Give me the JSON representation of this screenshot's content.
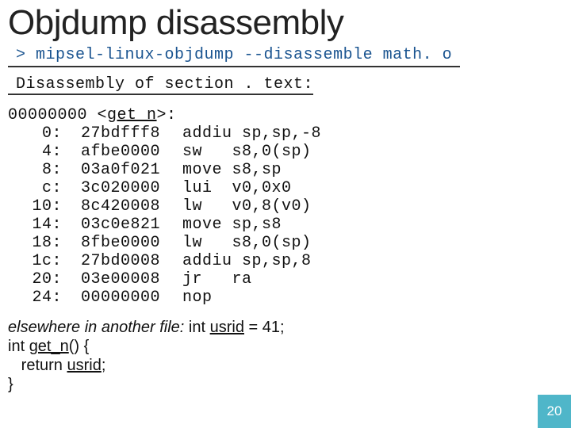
{
  "title": "Objdump disassembly",
  "command": "> mipsel-linux-objdump --disassemble math. o",
  "section_header": "Disassembly of section . text:",
  "symbol": {
    "addr": "00000000",
    "open": " <",
    "name": "get_n",
    "close": ">:"
  },
  "rows": [
    {
      "off": "0:",
      "hex": "27bdfff8",
      "ins": "addiu sp,sp,-8"
    },
    {
      "off": "4:",
      "hex": "afbe0000",
      "ins": "sw   s8,0(sp)"
    },
    {
      "off": "8:",
      "hex": "03a0f021",
      "ins": "move s8,sp"
    },
    {
      "off": "c:",
      "hex": "3c020000",
      "ins": "lui  v0,0x0"
    },
    {
      "off": "10:",
      "hex": "8c420008",
      "ins": "lw   v0,8(v0)"
    },
    {
      "off": "14:",
      "hex": "03c0e821",
      "ins": "move sp,s8"
    },
    {
      "off": "18:",
      "hex": "8fbe0000",
      "ins": "lw   s8,0(sp)"
    },
    {
      "off": "1c:",
      "hex": "27bd0008",
      "ins": "addiu sp,sp,8"
    },
    {
      "off": "20:",
      "hex": "03e00008",
      "ins": "jr   ra"
    },
    {
      "off": "24:",
      "hex": "00000000",
      "ins": "nop"
    }
  ],
  "elsewhere": {
    "l1a": "elsewhere in another file:",
    "l1b": " int ",
    "l1c": "usrid",
    "l1d": " = 41;",
    "l2a": "int ",
    "l2b": "get_n",
    "l2c": "() {",
    "l3": "   return ",
    "l3b": "usrid",
    "l3c": ";",
    "l4": "}"
  },
  "page": "20"
}
